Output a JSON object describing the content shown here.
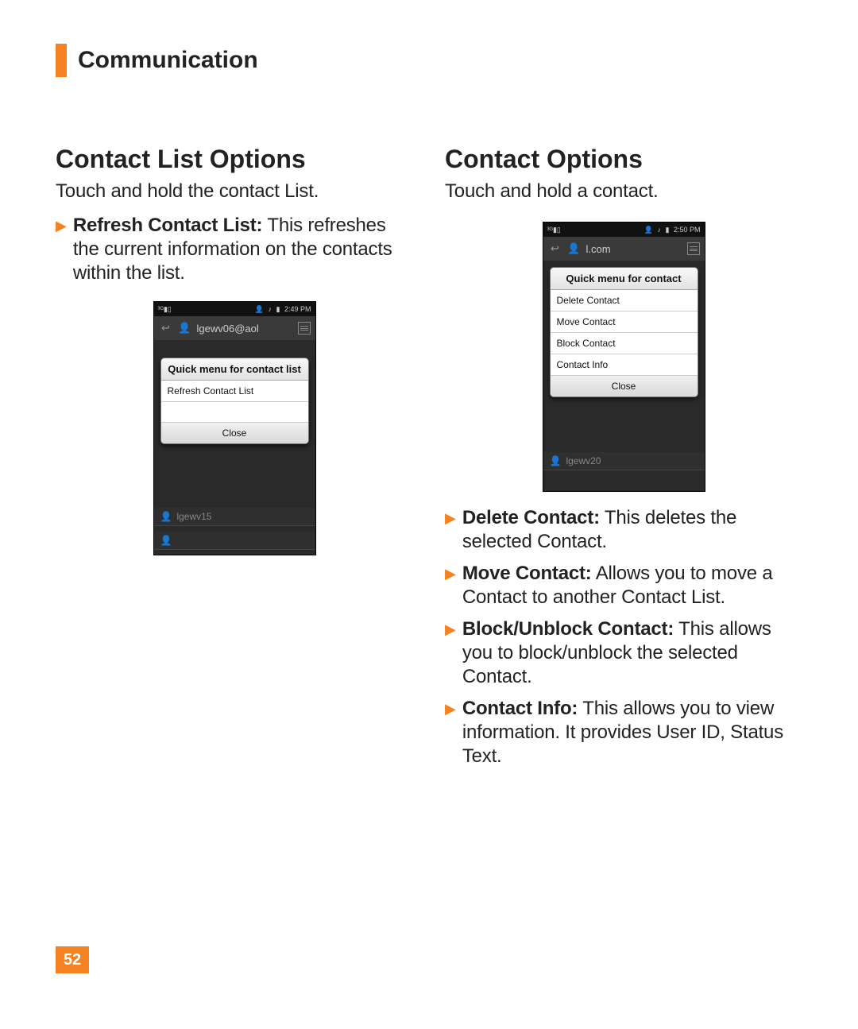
{
  "chapter": "Communication",
  "page_number": "52",
  "left": {
    "heading": "Contact List Options",
    "intro": "Touch and hold the contact List.",
    "bullets": [
      {
        "label": "Refresh Contact List:",
        "desc": " This refreshes the current information on the contacts within the list."
      }
    ],
    "phone": {
      "time": "2:49 PM",
      "title": "lgewv06@aol",
      "popup_title": "Quick menu for contact list",
      "items": [
        "Refresh Contact List"
      ],
      "empty_rows": 1,
      "close": "Close",
      "bg_contact": "lgewv15"
    }
  },
  "right": {
    "heading": "Contact Options",
    "intro": "Touch and hold a contact.",
    "phone": {
      "time": "2:50 PM",
      "title": "l.com",
      "popup_title": "Quick menu for contact",
      "items": [
        "Delete Contact",
        "Move Contact",
        "Block Contact",
        "Contact Info"
      ],
      "close": "Close",
      "bg_contact": "lgewv20"
    },
    "bullets": [
      {
        "label": "Delete Contact:",
        "desc": " This deletes the selected Contact."
      },
      {
        "label": "Move Contact:",
        "desc": " Allows you to move a Contact to another Contact List."
      },
      {
        "label": "Block/Unblock Contact:",
        "desc": " This allows you to block/unblock the selected Contact."
      },
      {
        "label": "Contact Info:",
        "desc": " This allows you to view information. It provides User ID, Status Text."
      }
    ]
  }
}
